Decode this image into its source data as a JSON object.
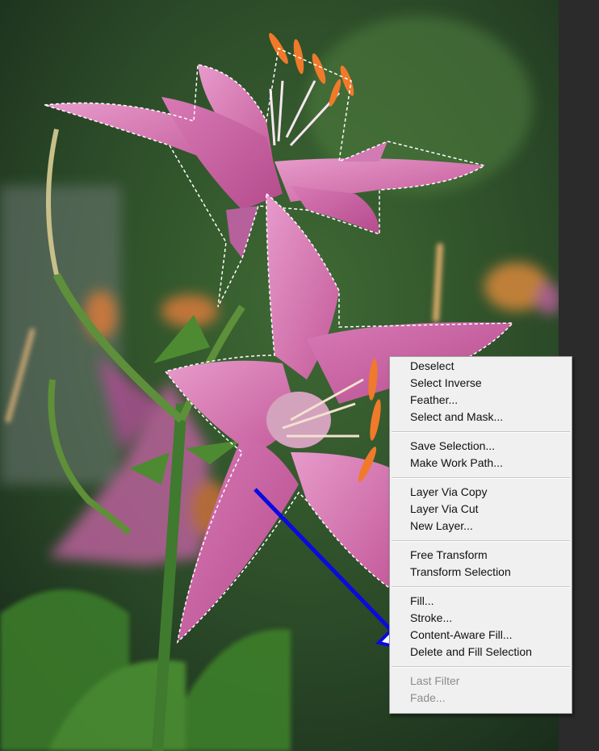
{
  "context_menu": {
    "groups": [
      [
        "Deselect",
        "Select Inverse",
        "Feather...",
        "Select and Mask..."
      ],
      [
        "Save Selection...",
        "Make Work Path..."
      ],
      [
        "Layer Via Copy",
        "Layer Via Cut",
        "New Layer..."
      ],
      [
        "Free Transform",
        "Transform Selection"
      ],
      [
        "Fill...",
        "Stroke...",
        "Content-Aware Fill...",
        "Delete and Fill Selection"
      ],
      [
        "Last Filter",
        "Fade..."
      ]
    ],
    "disabled": [
      "Last Filter",
      "Fade..."
    ]
  },
  "annotation": {
    "arrow_color": "#0a0ae0",
    "points_to": "Delete and Fill Selection"
  },
  "colors": {
    "menu_bg": "#f0f0f0",
    "menu_text": "#101010",
    "menu_disabled_text": "#8c8c8c",
    "panel_bg": "#2b2b2b",
    "lily_pink": "#d46aa8"
  }
}
